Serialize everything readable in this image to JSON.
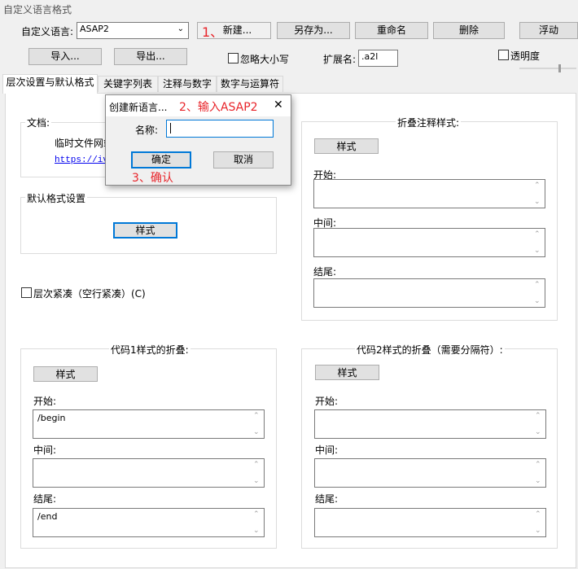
{
  "window": {
    "title": "自定义语言格式"
  },
  "toolbar": {
    "lang_label": "自定义语言:",
    "lang_value": "ASAP2",
    "new_btn": "新建...",
    "saveas_btn": "另存为...",
    "rename_btn": "重命名",
    "delete_btn": "删除",
    "float_btn": "浮动",
    "import_btn": "导入...",
    "export_btn": "导出...",
    "ignore_case": "忽略大小写",
    "ext_label": "扩展名:",
    "ext_value": ".a2l",
    "transparency": "透明度"
  },
  "tabs": [
    "层次设置与默认格式",
    "关键字列表",
    "注释与数字",
    "数字与运算符"
  ],
  "panel": {
    "doc_title": "文档:",
    "doc_text": "临时文件网站",
    "doc_link": "https://ivs",
    "default_title": "默认格式设置",
    "style_btn": "样式",
    "compact": "层次紧凑（空行紧凑）(C)",
    "fold_comment_title": "折叠注释样式:",
    "start_label": "开始:",
    "middle_label": "中间:",
    "end_label": "结尾:",
    "code1_title": "代码1样式的折叠:",
    "code2_title": "代码2样式的折叠（需要分隔符）:",
    "code1_start": "/begin",
    "code1_end": "/end"
  },
  "dialog": {
    "title": "创建新语言...",
    "name_label": "名称:",
    "name_value": "",
    "ok": "确定",
    "cancel": "取消"
  },
  "annotations": {
    "step1": "1、",
    "step2": "2、输入ASAP2",
    "step3": "3、确认"
  },
  "icons": {
    "dropdown": "chevron-down-icon",
    "close": "close-icon",
    "scroll_up": "scroll-up-icon",
    "scroll_down": "scroll-down-icon"
  }
}
